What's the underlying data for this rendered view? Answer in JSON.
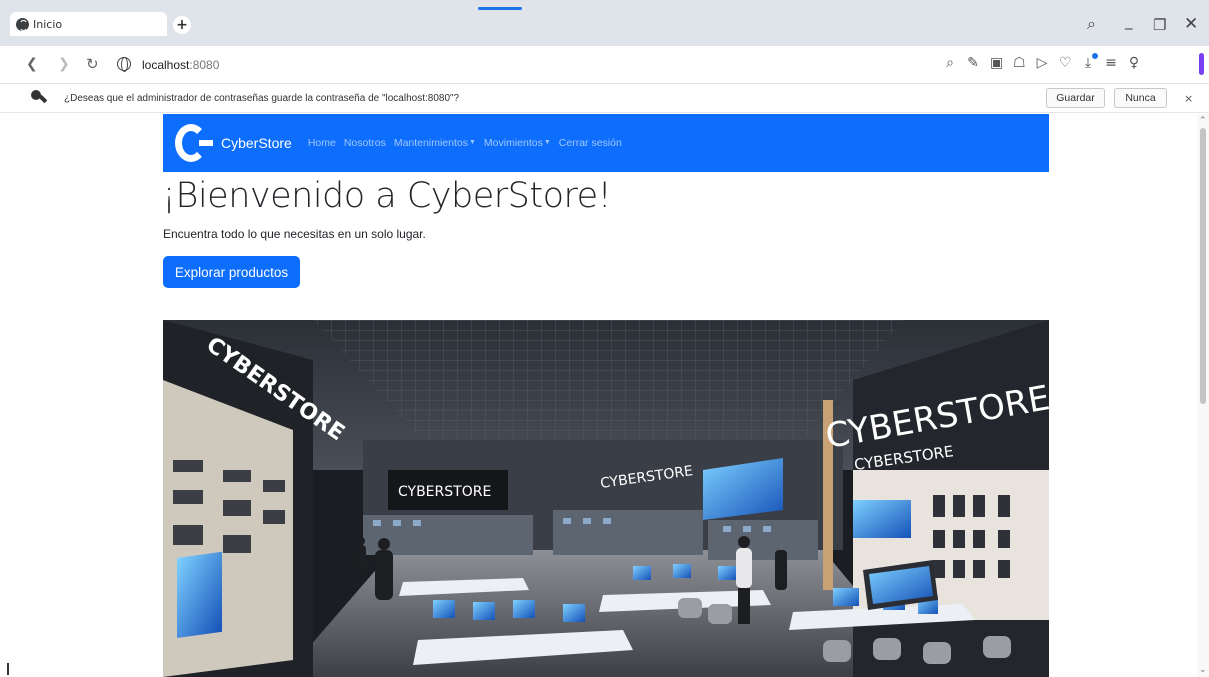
{
  "browser": {
    "tab_title": "Inicio",
    "new_tab_symbol": "+",
    "url_host": "localhost",
    "url_port": ":8080",
    "window_controls": [
      "search-icon",
      "minimize-icon",
      "restore-icon",
      "close-icon"
    ],
    "toolbar_icons": [
      "zoom-icon",
      "edit-icon",
      "screenshot-icon",
      "shield-icon",
      "send-icon",
      "heart-icon",
      "download-icon",
      "menu-icon",
      "profile-icon"
    ]
  },
  "password_bar": {
    "message": "¿Deseas que el administrador de contraseñas guarde la contraseña de \"localhost:8080\"?",
    "save_label": "Guardar",
    "never_label": "Nunca",
    "close_symbol": "×"
  },
  "navbar": {
    "brand": "CyberStore",
    "links": [
      "Home",
      "Nosotros",
      "Mantenimientos",
      "Movimientos",
      "Cerrar sesión"
    ],
    "color": "#0d6efd"
  },
  "hero": {
    "title": "¡Bienvenido a CyberStore!",
    "subtitle": "Encuentra todo lo que necesitas en un solo lugar.",
    "button": "Explorar productos"
  },
  "store_image": {
    "sign_main": "CYBERSTORE",
    "sign_sub": "CYBERSTORE",
    "sign_left": "CYBERSTORE",
    "sign_center": "CYBERSTORE",
    "sign_middle": "CYBERSTORE"
  }
}
